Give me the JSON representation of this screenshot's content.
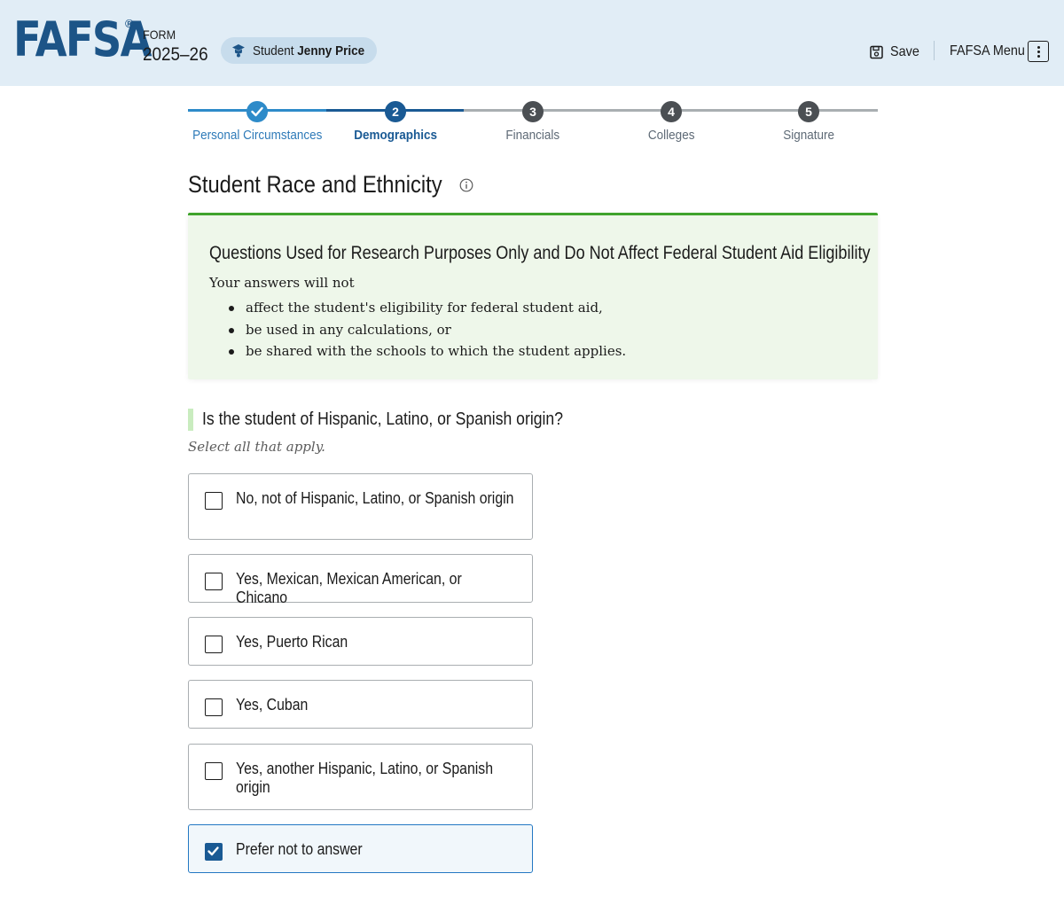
{
  "header": {
    "logo": "FAFSA",
    "logo_mark": "®",
    "form_label": "FORM",
    "form_year": "2025–26",
    "student_label": "Student",
    "student_name": "Jenny Price",
    "save_label": "Save",
    "menu_label": "FAFSA Menu"
  },
  "stepper": {
    "steps": [
      {
        "number": "1",
        "label": "Personal Circumstances",
        "status": "complete"
      },
      {
        "number": "2",
        "label": "Demographics",
        "status": "current"
      },
      {
        "number": "3",
        "label": "Financials",
        "status": "upcoming"
      },
      {
        "number": "4",
        "label": "Colleges",
        "status": "upcoming"
      },
      {
        "number": "5",
        "label": "Signature",
        "status": "upcoming"
      }
    ]
  },
  "page": {
    "title": "Student Race and Ethnicity"
  },
  "notice": {
    "title": "Questions Used for Research Purposes Only and Do Not Affect Federal Student Aid Eligibility",
    "intro": "Your answers will not",
    "items": [
      "affect the student's eligibility for federal student aid,",
      "be used in any calculations, or",
      "be shared with the schools to which the student applies."
    ]
  },
  "question": {
    "text": "Is the student of Hispanic, Latino, or Spanish origin?",
    "hint": "Select all that apply.",
    "options": [
      {
        "label": "No, not of Hispanic, Latino, or Spanish origin",
        "checked": false
      },
      {
        "label": "Yes, Mexican, Mexican American, or Chicano",
        "checked": false
      },
      {
        "label": "Yes, Puerto Rican",
        "checked": false
      },
      {
        "label": "Yes, Cuban",
        "checked": false
      },
      {
        "label": "Yes, another Hispanic, Latino, or Spanish origin",
        "checked": false
      },
      {
        "label": "Prefer not to answer",
        "checked": true
      }
    ]
  },
  "colors": {
    "brand": "#1c5487",
    "header_bg": "#e1edf6",
    "step_complete": "#2e8bc9",
    "step_current": "#1a5a94",
    "step_upcoming": "#4b4f53",
    "notice_accent": "#3fa32c",
    "notice_bg": "#eef7ea",
    "checked": "#1a5a94"
  },
  "icons": {
    "student": "graduation-cap-icon",
    "save": "save-disk-icon",
    "menu": "vertical-dots-icon",
    "info": "info-circle-icon",
    "check": "checkmark-icon"
  }
}
